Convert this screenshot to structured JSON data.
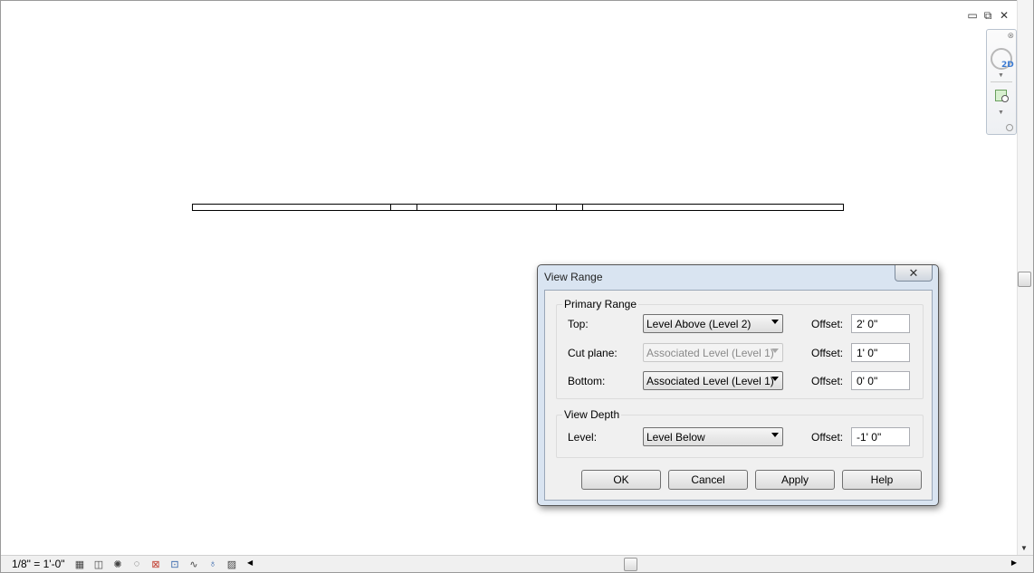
{
  "window_controls": {
    "minimize": "▭",
    "restore": "⧉",
    "close": "✕"
  },
  "nav_bar": {
    "steering_wheel_badge": "2D"
  },
  "status_bar": {
    "scale": "1/8\" = 1'-0\""
  },
  "dialog": {
    "title": "View Range",
    "primary_range": {
      "title": "Primary Range",
      "rows": [
        {
          "label": "Top:",
          "value": "Level Above (Level 2)",
          "offset_label": "Offset:",
          "offset": "2'  0\"",
          "enabled": true
        },
        {
          "label": "Cut plane:",
          "value": "Associated Level (Level 1)",
          "offset_label": "Offset:",
          "offset": "1'  0\"",
          "enabled": false
        },
        {
          "label": "Bottom:",
          "value": "Associated Level (Level 1)",
          "offset_label": "Offset:",
          "offset": "0'  0\"",
          "enabled": true
        }
      ]
    },
    "view_depth": {
      "title": "View Depth",
      "level_label": "Level:",
      "level_value": "Level Below",
      "offset_label": "Offset:",
      "offset": "-1'  0\""
    },
    "buttons": {
      "ok": "OK",
      "cancel": "Cancel",
      "apply": "Apply",
      "help": "Help"
    }
  }
}
